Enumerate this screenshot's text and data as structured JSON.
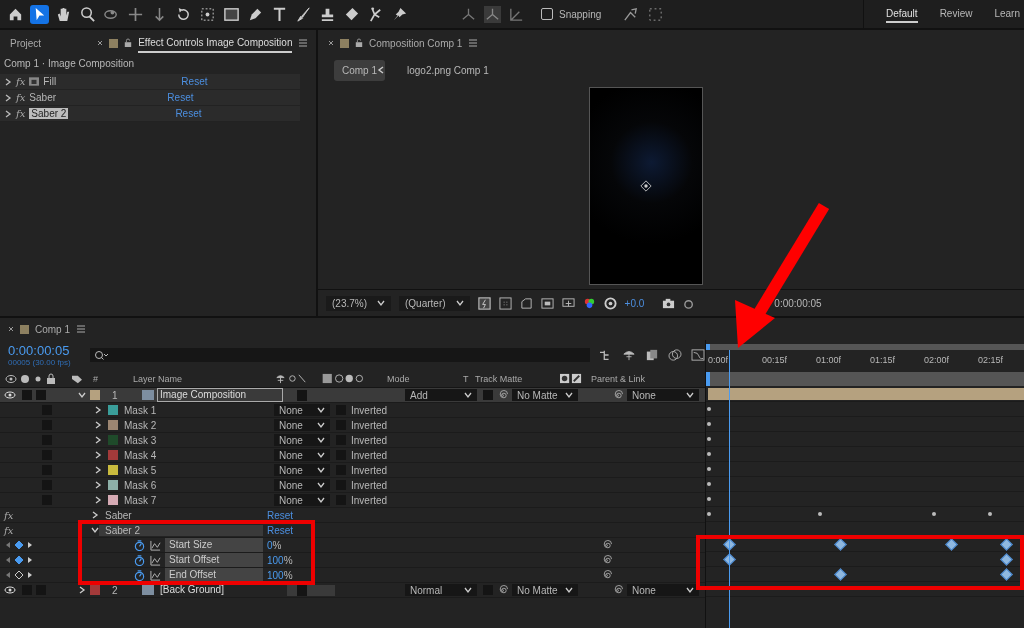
{
  "toolbar": {
    "snapping": {
      "label": "Snapping",
      "checked": false
    },
    "workspaces": [
      {
        "label": "Default",
        "selected": true
      },
      {
        "label": "Review",
        "selected": false
      },
      {
        "label": "Learn",
        "selected": false
      }
    ]
  },
  "effect_panel": {
    "tabs": [
      {
        "label": "Project",
        "selected": false
      },
      {
        "label": "Effect Controls Image Composition",
        "selected": true
      }
    ],
    "subtitle": "Comp 1 · Image Composition",
    "effects": [
      {
        "fx": "fx",
        "name": "Fill",
        "reset": "Reset",
        "selected": false
      },
      {
        "fx": "fx",
        "name": "Saber",
        "reset": "Reset",
        "selected": false
      },
      {
        "fx": "fx",
        "name": "Saber 2",
        "reset": "Reset",
        "selected": true
      }
    ]
  },
  "composition_panel": {
    "tab": "Composition Comp 1",
    "breadcrumbs": [
      {
        "label": "Comp 1",
        "selected": true
      },
      {
        "label": "logo2.png Comp 1",
        "selected": false
      }
    ],
    "zoom": "(23.7%)",
    "resolution": "(Quarter)",
    "exposure": "+0.0",
    "timecode": "0:00:00:05"
  },
  "timeline": {
    "tab": "Comp 1",
    "current_time": "0:00:00:05",
    "frame_info": "00005 (30.00 fps)",
    "columns": {
      "number": "#",
      "layer_name": "Layer Name",
      "mode": "Mode",
      "t": "T",
      "track_matte": "Track Matte",
      "parent": "Parent & Link"
    },
    "ruler": [
      "0:00f",
      "00:15f",
      "01:00f",
      "01:15f",
      "02:00f",
      "02:15f"
    ],
    "playhead": {
      "level": 0.07
    },
    "rows": [
      {
        "kind": "layer",
        "number": "1",
        "name": "Image Composition",
        "mode": "Add",
        "track_matte": "No Matte",
        "parent": "None",
        "expanded": true,
        "selected": true,
        "color": "#b5a17f"
      },
      {
        "kind": "mask",
        "name": "Mask 1",
        "color": "#3a9e9a",
        "mode": "None",
        "inverted": "Inverted",
        "checked": false,
        "keyframes": [
          {
            "level": 0.01
          }
        ]
      },
      {
        "kind": "mask",
        "name": "Mask 2",
        "color": "#9c8672",
        "mode": "None",
        "inverted": "Inverted",
        "checked": false,
        "keyframes": [
          {
            "level": 0.01
          }
        ]
      },
      {
        "kind": "mask",
        "name": "Mask 3",
        "color": "#1f4a2a",
        "mode": "None",
        "inverted": "Inverted",
        "checked": false,
        "keyframes": [
          {
            "level": 0.01
          }
        ]
      },
      {
        "kind": "mask",
        "name": "Mask 4",
        "color": "#a33a3a",
        "mode": "None",
        "inverted": "Inverted",
        "checked": false,
        "keyframes": [
          {
            "level": 0.01
          }
        ]
      },
      {
        "kind": "mask",
        "name": "Mask 5",
        "color": "#c9bb3e",
        "mode": "None",
        "inverted": "Inverted",
        "checked": false,
        "keyframes": [
          {
            "level": 0.01
          }
        ]
      },
      {
        "kind": "mask",
        "name": "Mask 6",
        "color": "#8db0a8",
        "mode": "None",
        "inverted": "Inverted",
        "checked": false,
        "keyframes": [
          {
            "level": 0.01
          }
        ]
      },
      {
        "kind": "mask",
        "name": "Mask 7",
        "color": "#d6aab4",
        "mode": "None",
        "inverted": "Inverted",
        "checked": false,
        "keyframes": [
          {
            "level": 0.01
          }
        ]
      },
      {
        "kind": "effect",
        "fx": "fx",
        "name": "Saber",
        "reset": "Reset",
        "expanded": false,
        "keyframes": [
          {
            "level": 0.01
          },
          {
            "level": 0.35
          },
          {
            "level": 0.7
          },
          {
            "level": 0.87
          }
        ]
      },
      {
        "kind": "effect",
        "fx": "fx",
        "name": "Saber 2",
        "reset": "Reset",
        "expanded": true,
        "keyframes": []
      },
      {
        "kind": "property",
        "name": "Start Size",
        "value": "0",
        "unit": "%",
        "keyframe_here": true,
        "keyframes": [
          {
            "level": 0.07
          },
          {
            "level": 0.41
          },
          {
            "level": 0.75
          },
          {
            "level": 0.92
          }
        ]
      },
      {
        "kind": "property",
        "name": "Start Offset",
        "value": "100",
        "unit": "%",
        "keyframe_here": true,
        "keyframes": [
          {
            "level": 0.07
          },
          {
            "level": 0.92
          }
        ]
      },
      {
        "kind": "property",
        "name": "End Offset",
        "value": "100",
        "unit": "%",
        "keyframe_here": false,
        "keyframes": [
          {
            "level": 0.41
          },
          {
            "level": 0.92
          }
        ]
      },
      {
        "kind": "layer",
        "number": "2",
        "name": "[Back Ground]",
        "mode": "Normal",
        "track_matte": "No Matte",
        "parent": "None",
        "expanded": false,
        "selected": false,
        "color": "#a33a3a"
      }
    ]
  }
}
